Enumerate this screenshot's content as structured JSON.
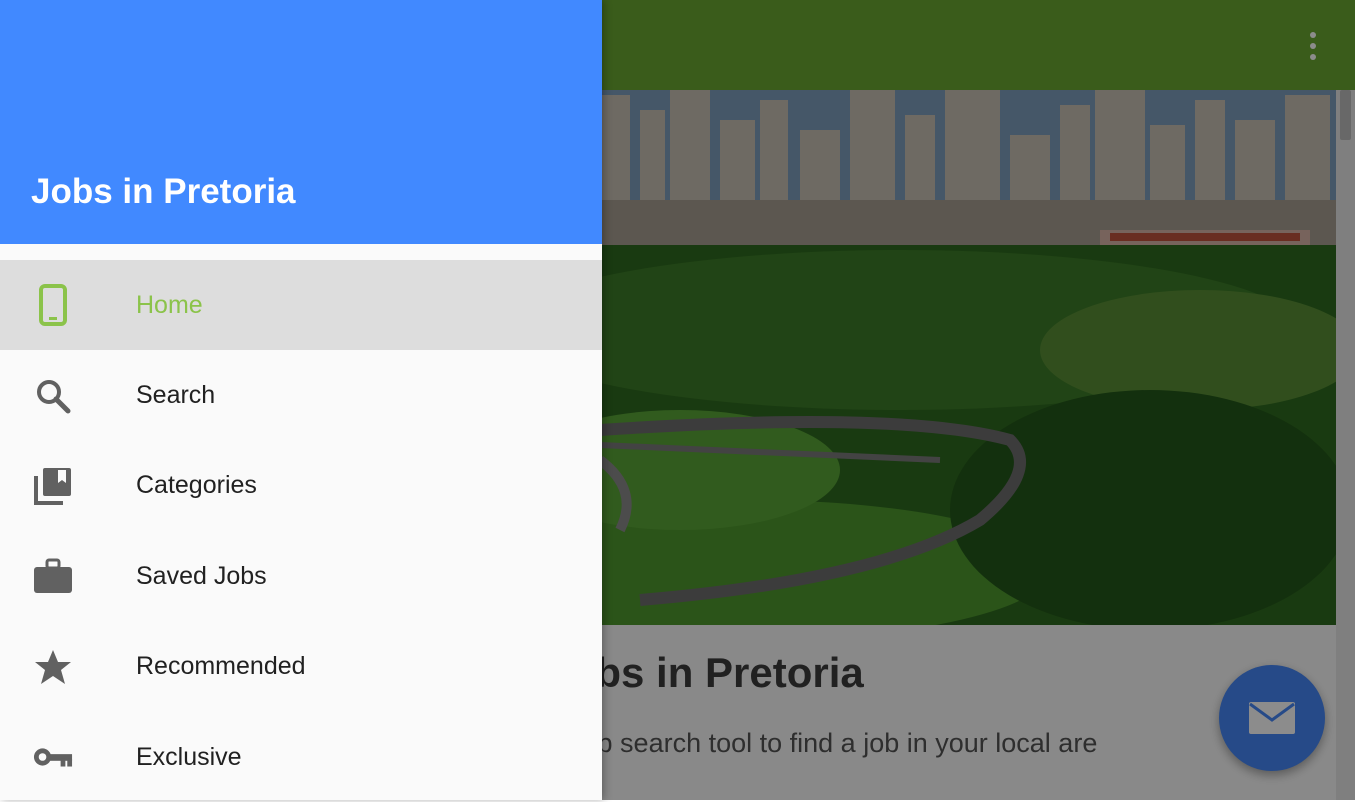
{
  "app": {
    "content_title": "r jobs in Pretoria",
    "content_text": "our job search tool to find a job in your local are",
    "fab_icon": "mail-icon",
    "overflow_icon": "more-vert-icon"
  },
  "drawer": {
    "title": "Jobs in Pretoria",
    "items": [
      {
        "label": "Home",
        "icon": "phone-icon",
        "active": true
      },
      {
        "label": "Search",
        "icon": "search-icon",
        "active": false
      },
      {
        "label": "Categories",
        "icon": "collections-icon",
        "active": false
      },
      {
        "label": "Saved Jobs",
        "icon": "briefcase-icon",
        "active": false
      },
      {
        "label": "Recommended",
        "icon": "star-icon",
        "active": false
      },
      {
        "label": "Exclusive",
        "icon": "key-icon",
        "active": false
      }
    ]
  },
  "colors": {
    "toolbar": "#6aa832",
    "drawer_header": "#4189ff",
    "active_item_text": "#8bc34a",
    "fab": "#4587f7"
  }
}
